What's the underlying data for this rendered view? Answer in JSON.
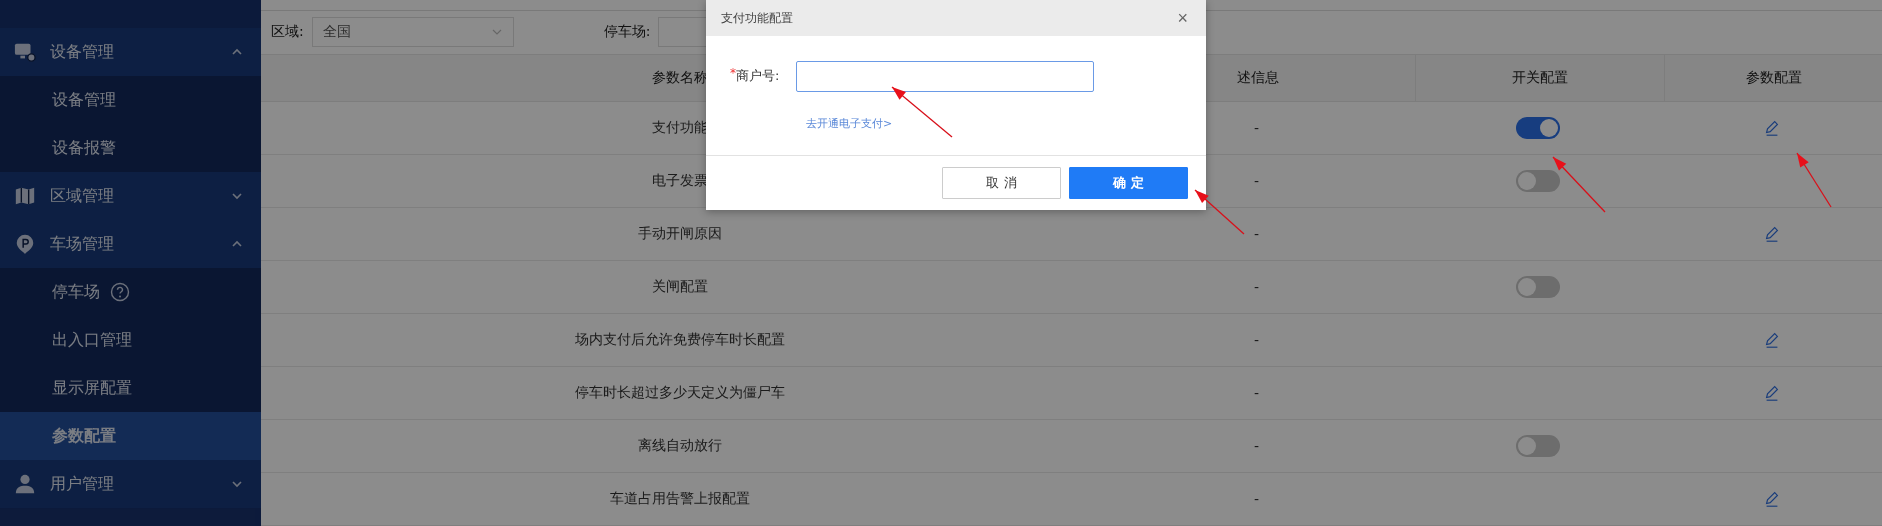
{
  "sidebar": {
    "groups": [
      {
        "label": "设备管理",
        "expanded": true,
        "children": [
          {
            "label": "设备管理",
            "selected": false
          },
          {
            "label": "设备报警",
            "selected": false
          }
        ]
      },
      {
        "label": "区域管理",
        "expanded": false
      },
      {
        "label": "车场管理",
        "expanded": true,
        "children": [
          {
            "label": "停车场",
            "selected": false,
            "help": true
          },
          {
            "label": "出入口管理",
            "selected": false
          },
          {
            "label": "显示屏配置",
            "selected": false
          },
          {
            "label": "参数配置",
            "selected": true
          }
        ]
      },
      {
        "label": "用户管理",
        "expanded": false
      }
    ]
  },
  "filters": [
    {
      "label": "区域:",
      "value": "全国"
    },
    {
      "label": "停车场:"
    }
  ],
  "table": {
    "columns": [
      "参数名称",
      "述信息",
      "开关配置",
      "参数配置"
    ],
    "rows": [
      {
        "name": "支付功能",
        "description": "-",
        "switch": {
          "on": true
        },
        "editable": true
      },
      {
        "name": "电子发票",
        "description": "-",
        "switch": {
          "on": false
        },
        "editable": false
      },
      {
        "name": "手动开闸原因",
        "description": "-",
        "editable": true
      },
      {
        "name": "关闸配置",
        "description": "-",
        "switch": {
          "on": false
        },
        "editable": false
      },
      {
        "name": "场内支付后允许免费停车时长配置",
        "description": "-",
        "editable": true
      },
      {
        "name": "停车时长超过多少天定义为僵尸车",
        "description": "-",
        "editable": true
      },
      {
        "name": "离线自动放行",
        "description": "-",
        "switch": {
          "on": false
        },
        "editable": false
      },
      {
        "name": "车道占用告警上报配置",
        "description": "-",
        "editable": true
      }
    ]
  },
  "dialog": {
    "title": "支付功能配置",
    "close": "×",
    "field": {
      "required_mark": "*",
      "label": "商户号:"
    },
    "link": "去开通电子支付>",
    "buttons": [
      {
        "label": "取 消",
        "kind": "secondary"
      },
      {
        "label": "确 定",
        "kind": "primary"
      }
    ]
  }
}
